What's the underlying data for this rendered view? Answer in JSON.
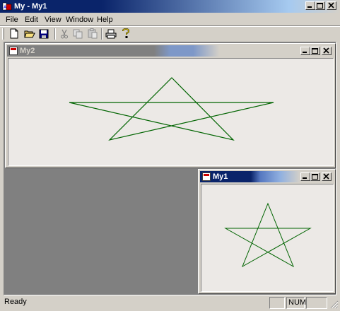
{
  "app": {
    "title": "My - My1"
  },
  "menu": {
    "items": [
      {
        "label": "File"
      },
      {
        "label": "Edit"
      },
      {
        "label": "View"
      },
      {
        "label": "Window"
      },
      {
        "label": "Help"
      }
    ]
  },
  "toolbar": {
    "buttons": [
      {
        "icon": "new-file-icon"
      },
      {
        "icon": "open-folder-icon"
      },
      {
        "icon": "save-icon"
      },
      {
        "icon": "cut-icon"
      },
      {
        "icon": "copy-icon"
      },
      {
        "icon": "paste-icon"
      },
      {
        "icon": "print-icon"
      },
      {
        "icon": "help-icon"
      }
    ]
  },
  "child_windows": [
    {
      "title": "My2",
      "active": false
    },
    {
      "title": "My1",
      "active": true
    }
  ],
  "statusbar": {
    "message": "Ready",
    "panes": [
      "",
      "NUM",
      ""
    ]
  },
  "colors": {
    "active_title_start": "#0a246a",
    "active_title_end": "#a6caf0",
    "inactive_title_start": "#808080",
    "inactive_title_end": "#c0c0c0",
    "mdi_background": "#808080",
    "client_background": "#ece9e6",
    "star_stroke": "#006400"
  }
}
